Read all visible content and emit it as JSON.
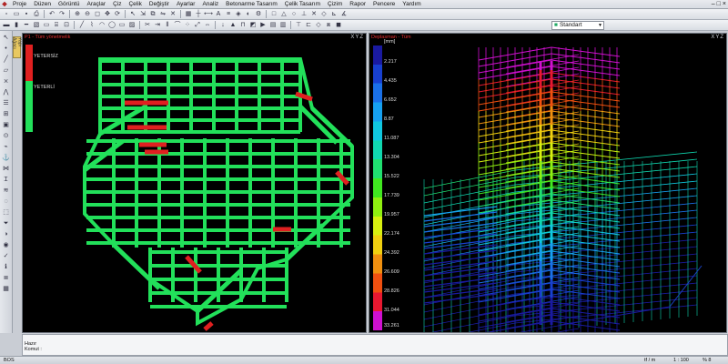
{
  "menubar": {
    "items": [
      "Proje",
      "Düzen",
      "Görüntü",
      "Araçlar",
      "Çiz",
      "Çelik",
      "Değiştir",
      "Ayarlar",
      "Analiz",
      "Betonarme Tasarım",
      "Çelik Tasarım",
      "Çizim",
      "Rapor",
      "Pencere",
      "Yardım"
    ],
    "window_controls": [
      "–",
      "□",
      "×"
    ]
  },
  "toolbar": {
    "material_select": "Standart"
  },
  "side_tab": {
    "label": "Yapı Ağacı"
  },
  "left_view": {
    "title": "P1 - Tüm yönetmelik",
    "corner": "XYZ",
    "legend": [
      {
        "label": "YETERSİZ",
        "color": "#e02020"
      },
      {
        "label": "YETERLİ",
        "color": "#22e05a"
      }
    ]
  },
  "right_view": {
    "title": "Deplasman - Tüm",
    "corner": "XYZ",
    "unit": "[mm]",
    "colorbar_labels": [
      "2.217",
      "4.435",
      "6.652",
      "8.87",
      "11.087",
      "13.304",
      "15.522",
      "17.739",
      "19.957",
      "22.174",
      "24.392",
      "26.609",
      "28.826",
      "31.044",
      "33.261"
    ],
    "colors": [
      "#1a1aa0",
      "#1840d0",
      "#1a70e8",
      "#16a0f0",
      "#10c8e0",
      "#10d8b0",
      "#20e070",
      "#40e820",
      "#90f010",
      "#d8f010",
      "#f0d010",
      "#f09010",
      "#f05010",
      "#e81830",
      "#d010d0"
    ]
  },
  "command": {
    "line1": "Hazır",
    "line2": "Komut :"
  },
  "status": {
    "left": "BOS",
    "unit": "tf / m",
    "scale": "1 : 100",
    "zoom": "% 8"
  }
}
